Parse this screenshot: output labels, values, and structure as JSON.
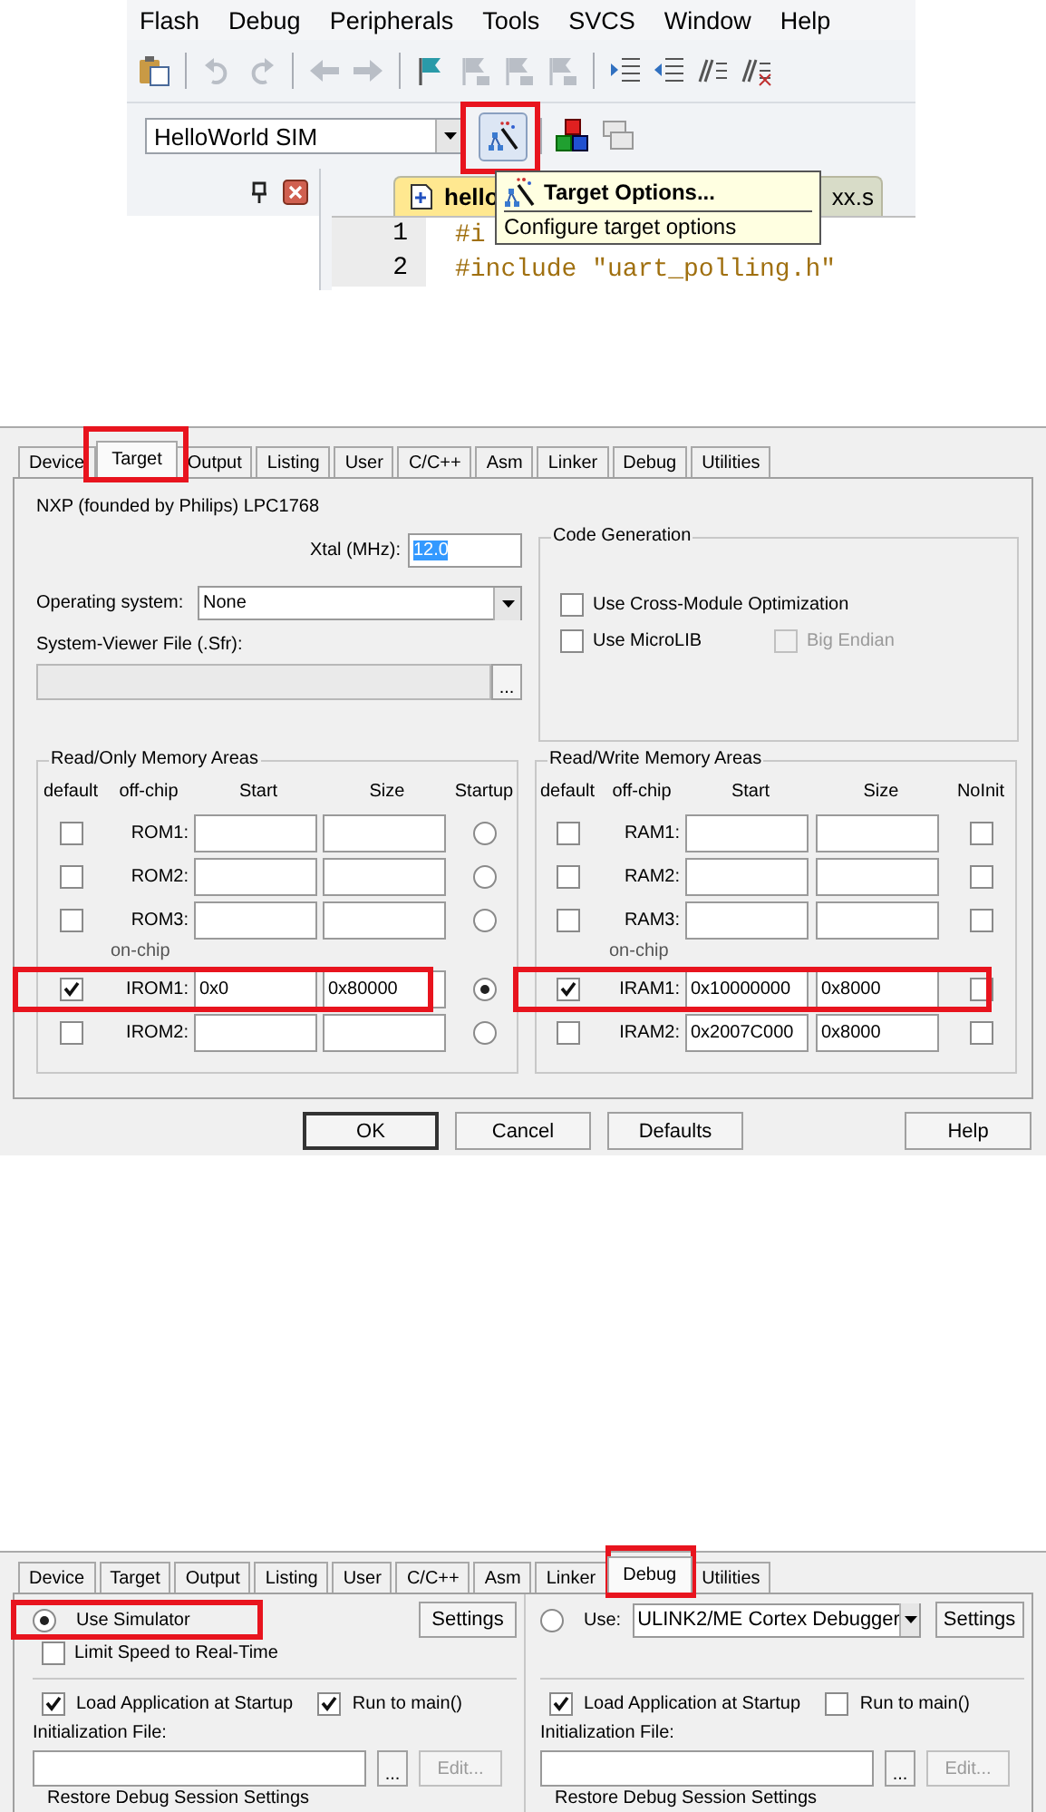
{
  "ide": {
    "menu": [
      "Flash",
      "Debug",
      "Peripherals",
      "Tools",
      "SVCS",
      "Window",
      "Help"
    ],
    "toolbar": [
      {
        "kind": "paste",
        "disabled": false
      },
      {
        "kind": "undo",
        "disabled": true
      },
      {
        "kind": "redo",
        "disabled": true
      },
      {
        "kind": "back",
        "disabled": true
      },
      {
        "kind": "forward",
        "disabled": true
      },
      {
        "kind": "flag",
        "disabled": false
      },
      {
        "kind": "flagprev",
        "disabled": true
      },
      {
        "kind": "flagnext",
        "disabled": true
      },
      {
        "kind": "flagclear",
        "disabled": true
      },
      {
        "kind": "indent",
        "disabled": false
      },
      {
        "kind": "outdent",
        "disabled": false
      },
      {
        "kind": "comment",
        "disabled": false
      },
      {
        "kind": "uncomment",
        "disabled": false
      }
    ],
    "target": "HelloWorld SIM",
    "target_options_button": {
      "highlighted": true
    },
    "tooltip": {
      "title": "Target Options...",
      "description": "Configure target options"
    },
    "editor_tabs": [
      {
        "label": "hello",
        "selected": true
      },
      {
        "label": "xx.s",
        "selected": false
      }
    ],
    "code": [
      {
        "line": "1",
        "text": "#i"
      },
      {
        "line": "2",
        "text": "#include \"uart_polling.h\""
      }
    ]
  },
  "target_dialog": {
    "tabs": [
      {
        "label": "Device",
        "selected": false,
        "highlighted": false
      },
      {
        "label": "Target",
        "selected": true,
        "highlighted": true
      },
      {
        "label": "Output",
        "selected": false,
        "highlighted": false
      },
      {
        "label": "Listing",
        "selected": false,
        "highlighted": false
      },
      {
        "label": "User",
        "selected": false,
        "highlighted": false
      },
      {
        "label": "C/C++",
        "selected": false,
        "highlighted": false
      },
      {
        "label": "Asm",
        "selected": false,
        "highlighted": false
      },
      {
        "label": "Linker",
        "selected": false,
        "highlighted": false
      },
      {
        "label": "Debug",
        "selected": false,
        "highlighted": false
      },
      {
        "label": "Utilities",
        "selected": false,
        "highlighted": false
      }
    ],
    "device": "NXP (founded by Philips) LPC1768",
    "xtal": {
      "label": "Xtal (MHz):",
      "value": "12.0",
      "text_selected": true
    },
    "os": {
      "label": "Operating system:",
      "value": "None"
    },
    "sfr": {
      "label": "System-Viewer File (.Sfr):",
      "browse": "...",
      "disabled": true
    },
    "code_generation": {
      "title": "Code Generation",
      "options": [
        {
          "label": "Use Cross-Module Optimization",
          "checked": false,
          "disabled": false
        },
        {
          "label": "Use MicroLIB",
          "checked": false,
          "disabled": false
        },
        {
          "label": "Big Endian",
          "checked": false,
          "disabled": true
        }
      ]
    },
    "rom": {
      "title": "Read/Only Memory Areas",
      "columns": [
        "default",
        "off-chip",
        "Start",
        "Size",
        "Startup"
      ],
      "onchip_label": "on-chip",
      "off_chip": [
        {
          "name": "ROM1:",
          "default": false,
          "startup": false
        },
        {
          "name": "ROM2:",
          "default": false,
          "startup": false
        },
        {
          "name": "ROM3:",
          "default": false,
          "startup": false
        }
      ],
      "on_chip": [
        {
          "name": "IROM1:",
          "default": true,
          "start": "0x0",
          "size": "0x80000",
          "startup": true,
          "highlighted": true
        },
        {
          "name": "IROM2:",
          "default": false,
          "startup": false,
          "highlighted": false
        }
      ]
    },
    "ram": {
      "title": "Read/Write Memory Areas",
      "columns": [
        "default",
        "off-chip",
        "Start",
        "Size",
        "NoInit"
      ],
      "onchip_label": "on-chip",
      "off_chip": [
        {
          "name": "RAM1:",
          "default": false,
          "noinit": false
        },
        {
          "name": "RAM2:",
          "default": false,
          "noinit": false
        },
        {
          "name": "RAM3:",
          "default": false,
          "noinit": false
        }
      ],
      "on_chip": [
        {
          "name": "IRAM1:",
          "default": true,
          "start": "0x10000000",
          "size": "0x8000",
          "noinit": false,
          "highlighted": true
        },
        {
          "name": "IRAM2:",
          "default": false,
          "start": "0x2007C000",
          "size": "0x8000",
          "noinit": false,
          "highlighted": false
        }
      ]
    },
    "buttons": [
      {
        "label": "OK",
        "default": true
      },
      {
        "label": "Cancel",
        "default": false
      },
      {
        "label": "Defaults",
        "default": false
      },
      {
        "label": "Help",
        "default": false
      }
    ]
  },
  "debug_dialog": {
    "tabs": [
      {
        "label": "Device",
        "selected": false,
        "highlighted": false
      },
      {
        "label": "Target",
        "selected": false,
        "highlighted": false
      },
      {
        "label": "Output",
        "selected": false,
        "highlighted": false
      },
      {
        "label": "Listing",
        "selected": false,
        "highlighted": false
      },
      {
        "label": "User",
        "selected": false,
        "highlighted": false
      },
      {
        "label": "C/C++",
        "selected": false,
        "highlighted": false
      },
      {
        "label": "Asm",
        "selected": false,
        "highlighted": false
      },
      {
        "label": "Linker",
        "selected": false,
        "highlighted": false
      },
      {
        "label": "Debug",
        "selected": true,
        "highlighted": true
      },
      {
        "label": "Utilities",
        "selected": false,
        "highlighted": false
      }
    ],
    "sides": [
      {
        "mode": {
          "label": "Use Simulator",
          "selected": true,
          "highlighted": true
        },
        "settings": "Settings",
        "limit_speed": {
          "label": "Limit Speed to Real-Time",
          "checked": false
        },
        "load_app": {
          "label": "Load Application at Startup",
          "checked": true
        },
        "run_to_main": {
          "label": "Run to main()",
          "checked": true
        },
        "init_label": "Initialization File:",
        "browse": "...",
        "edit": {
          "label": "Edit...",
          "disabled": true
        },
        "restore": "Restore Debug Session Settings"
      },
      {
        "mode": {
          "label": "Use:",
          "selected": false,
          "highlighted": false
        },
        "debugger": "ULINK2/ME Cortex Debugger",
        "settings": "Settings",
        "load_app": {
          "label": "Load Application at Startup",
          "checked": true
        },
        "run_to_main": {
          "label": "Run to main()",
          "checked": false
        },
        "init_label": "Initialization File:",
        "browse": "...",
        "edit": {
          "label": "Edit...",
          "disabled": true
        },
        "restore": "Restore Debug Session Settings"
      }
    ]
  }
}
